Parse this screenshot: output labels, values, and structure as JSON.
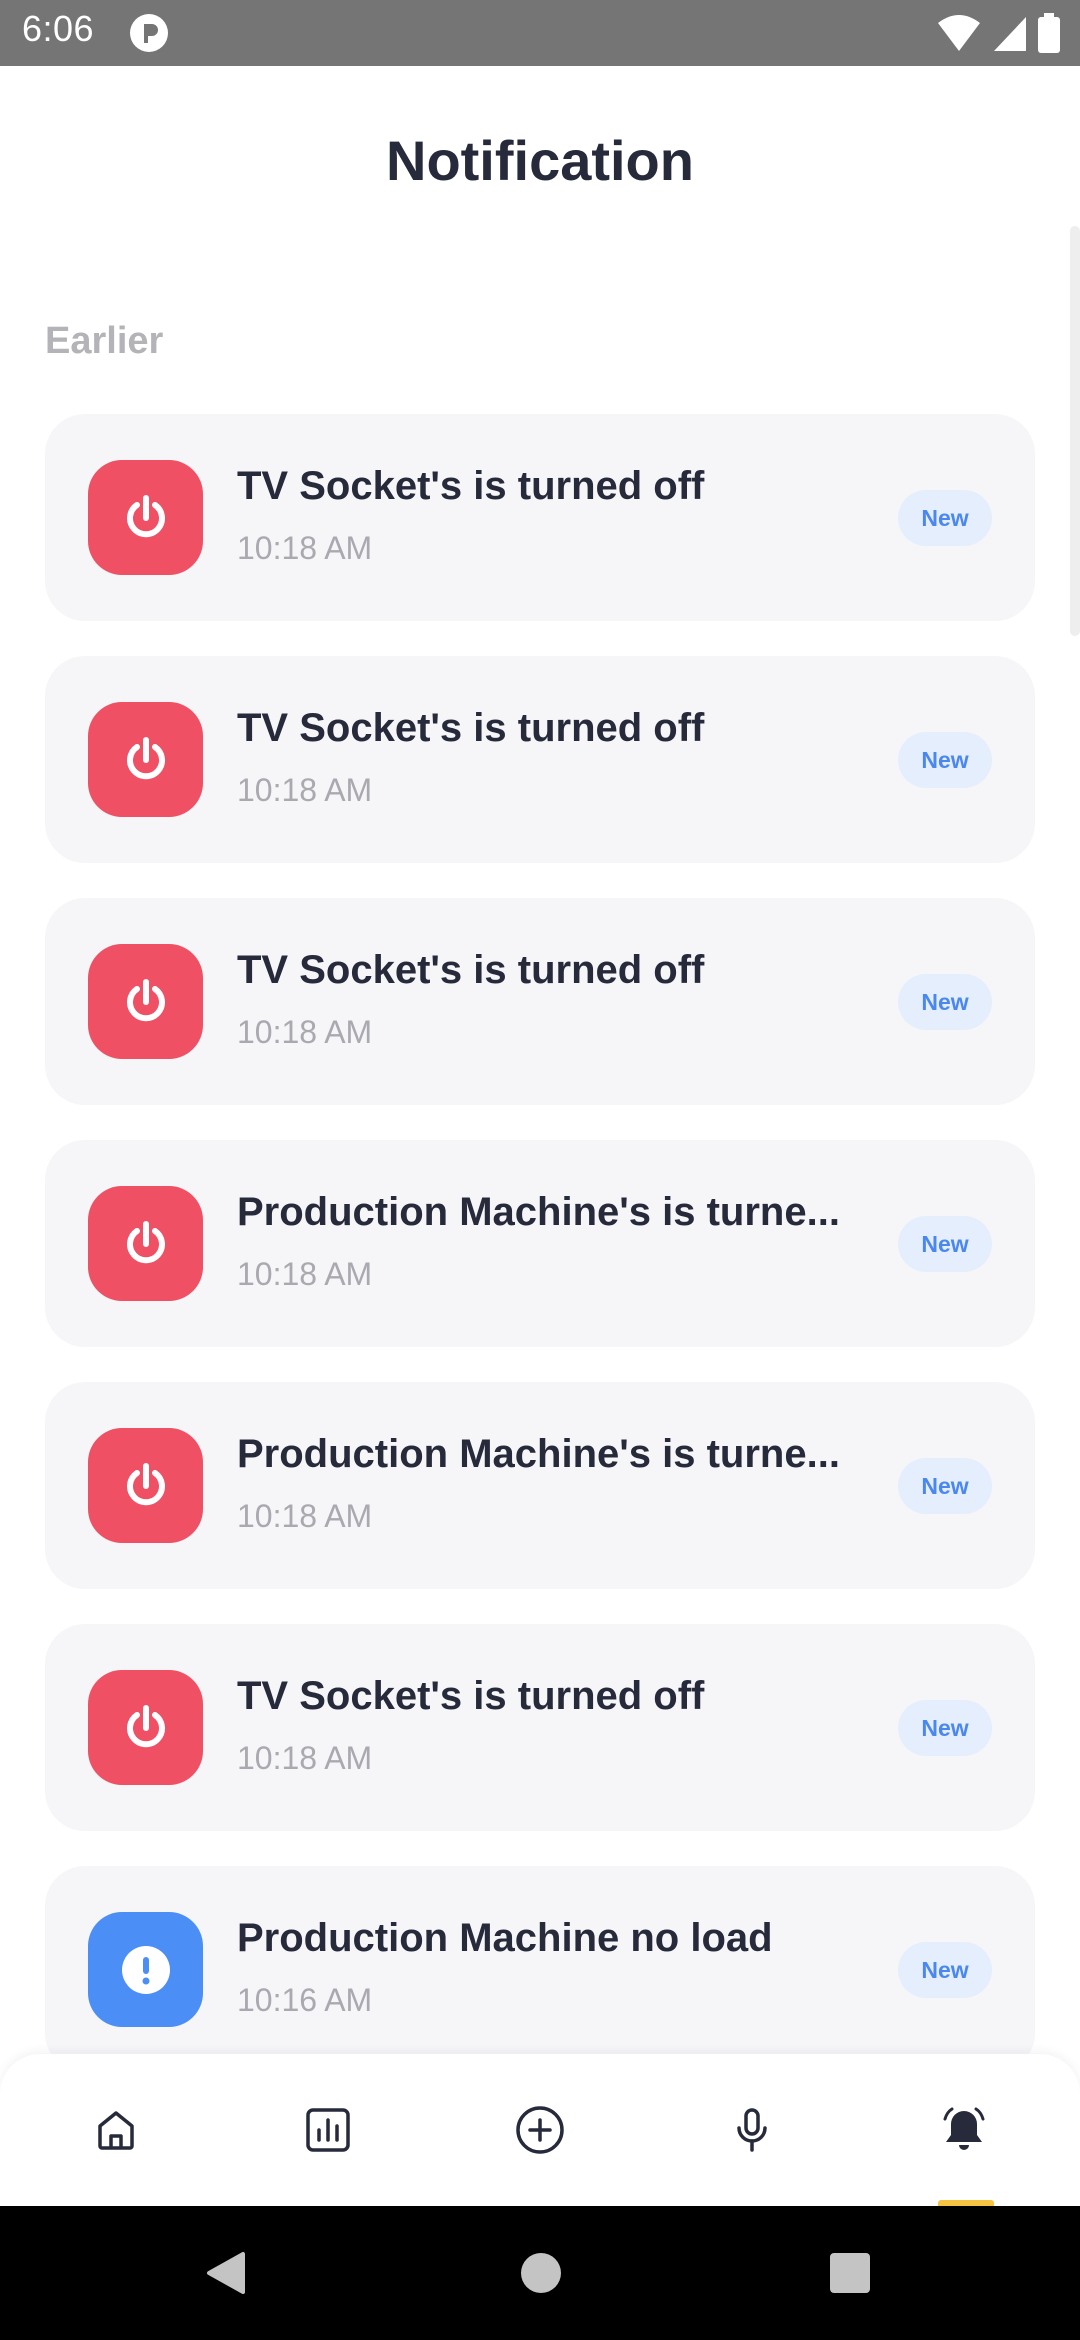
{
  "status_bar": {
    "time": "6:06"
  },
  "header": {
    "title": "Notification"
  },
  "section": {
    "label": "Earlier"
  },
  "notifications": [
    {
      "title": "TV Socket's is turned off",
      "time": "10:18 AM",
      "badge": "New",
      "icon": "power-icon",
      "color": "#ef5064"
    },
    {
      "title": "TV Socket's is turned off",
      "time": "10:18 AM",
      "badge": "New",
      "icon": "power-icon",
      "color": "#ef5064"
    },
    {
      "title": "TV Socket's is turned off",
      "time": "10:18 AM",
      "badge": "New",
      "icon": "power-icon",
      "color": "#ef5064"
    },
    {
      "title": "Production Machine's is turne...",
      "time": "10:18 AM",
      "badge": "New",
      "icon": "power-icon",
      "color": "#ef5064"
    },
    {
      "title": "Production Machine's is turne...",
      "time": "10:18 AM",
      "badge": "New",
      "icon": "power-icon",
      "color": "#ef5064"
    },
    {
      "title": "TV Socket's is turned off",
      "time": "10:18 AM",
      "badge": "New",
      "icon": "power-icon",
      "color": "#ef5064"
    },
    {
      "title": "Production Machine no load",
      "time": "10:16 AM",
      "badge": "New",
      "icon": "alert-icon",
      "color": "#4b8ef5"
    }
  ],
  "bottom_nav": {
    "items": [
      {
        "name": "home",
        "icon": "home-icon"
      },
      {
        "name": "stats",
        "icon": "bar-chart-icon"
      },
      {
        "name": "add",
        "icon": "add-circle-icon"
      },
      {
        "name": "voice",
        "icon": "microphone-icon"
      },
      {
        "name": "notifications",
        "icon": "bell-icon",
        "active": true
      }
    ],
    "active_indicator_color": "#f6c343"
  }
}
